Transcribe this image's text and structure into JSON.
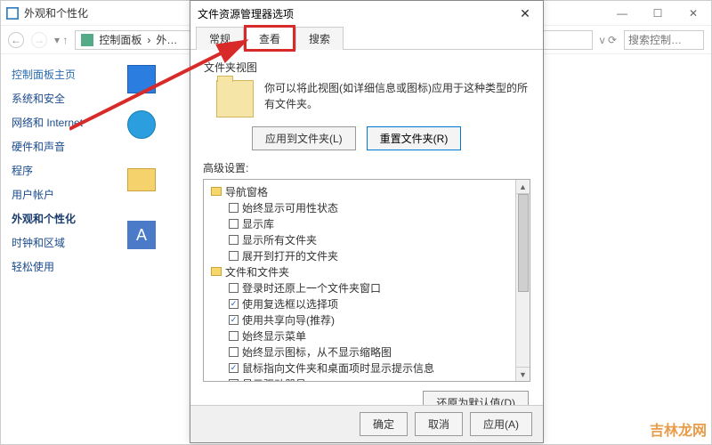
{
  "main": {
    "title": "外观和个性化",
    "breadcrumb": {
      "root": "控制面板",
      "current": "外…"
    },
    "search_placeholder": "搜索控制…",
    "sidebar": {
      "heading": "控制面板主页",
      "items": [
        "系统和安全",
        "网络和 Internet",
        "硬件和声音",
        "程序",
        "用户帐户",
        "外观和个性化",
        "时钟和区域",
        "轻松使用"
      ],
      "active_index": 5
    }
  },
  "dialog": {
    "title": "文件资源管理器选项",
    "tabs": [
      "常规",
      "查看",
      "搜索"
    ],
    "folderview": {
      "label": "文件夹视图",
      "desc": "你可以将此视图(如详细信息或图标)应用于这种类型的所有文件夹。",
      "apply_btn": "应用到文件夹(L)",
      "reset_btn": "重置文件夹(R)"
    },
    "advanced_label": "高级设置:",
    "tree": [
      {
        "level": 1,
        "type": "folder",
        "label": "导航窗格"
      },
      {
        "level": 2,
        "type": "check",
        "checked": false,
        "label": "始终显示可用性状态"
      },
      {
        "level": 2,
        "type": "check",
        "checked": false,
        "label": "显示库"
      },
      {
        "level": 2,
        "type": "check",
        "checked": false,
        "label": "显示所有文件夹"
      },
      {
        "level": 2,
        "type": "check",
        "checked": false,
        "label": "展开到打开的文件夹"
      },
      {
        "level": 1,
        "type": "folder",
        "label": "文件和文件夹"
      },
      {
        "level": 2,
        "type": "check",
        "checked": false,
        "label": "登录时还原上一个文件夹窗口"
      },
      {
        "level": 2,
        "type": "check",
        "checked": true,
        "label": "使用复选框以选择项"
      },
      {
        "level": 2,
        "type": "check",
        "checked": true,
        "label": "使用共享向导(推荐)"
      },
      {
        "level": 2,
        "type": "check",
        "checked": false,
        "label": "始终显示菜单"
      },
      {
        "level": 2,
        "type": "check",
        "checked": false,
        "label": "始终显示图标，从不显示缩略图"
      },
      {
        "level": 2,
        "type": "check",
        "checked": true,
        "label": "鼠标指向文件夹和桌面项时显示提示信息"
      },
      {
        "level": 2,
        "type": "check",
        "checked": true,
        "label": "显示驱动器号"
      }
    ],
    "restore_defaults": "还原为默认值(D)",
    "footer": {
      "ok": "确定",
      "cancel": "取消",
      "apply": "应用(A)"
    }
  },
  "watermark": "吉林龙网"
}
